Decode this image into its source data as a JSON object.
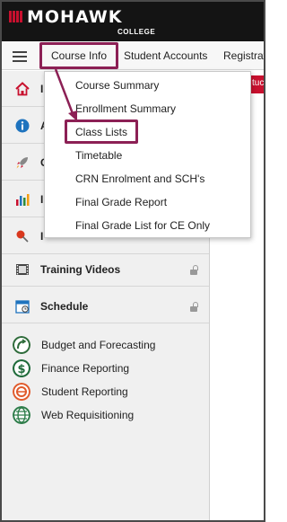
{
  "header": {
    "logo_text": "MOHAWK",
    "logo_sub": "COLLEGE",
    "brand_color": "#c8102e"
  },
  "topnav": {
    "menu_icon": "hamburger-menu-icon",
    "items": [
      "Course Info",
      "Student Accounts",
      "Registrat"
    ],
    "highlight_color": "#8c2055",
    "peek_text": "tuc"
  },
  "sidebar": {
    "rows": [
      {
        "label": "I",
        "icon": "home-icon"
      },
      {
        "label": "A",
        "icon": "info-icon"
      },
      {
        "label": "C",
        "icon": "rocket-icon"
      },
      {
        "label": "I",
        "icon": "bar-chart-icon"
      },
      {
        "label": "I",
        "icon": "pushpin-icon"
      },
      {
        "label": "Training Videos",
        "icon": "film-icon",
        "locked": true
      },
      {
        "label": "Schedule",
        "icon": "calendar-icon",
        "locked": true
      }
    ],
    "apps": [
      {
        "label": "Budget and Forecasting",
        "icon": "budget-icon"
      },
      {
        "label": "Finance Reporting",
        "icon": "dollar-icon"
      },
      {
        "label": "Student Reporting",
        "icon": "student-reporting-icon"
      },
      {
        "label": "Web Requisitioning",
        "icon": "globe-icon"
      }
    ]
  },
  "dropdown": {
    "items": [
      "Course Summary",
      "Enrollment Summary",
      "Class Lists",
      "Timetable",
      "CRN Enrolment and SCH's",
      "Final Grade Report",
      "Final Grade List for CE Only"
    ],
    "highlighted": "Class Lists"
  }
}
